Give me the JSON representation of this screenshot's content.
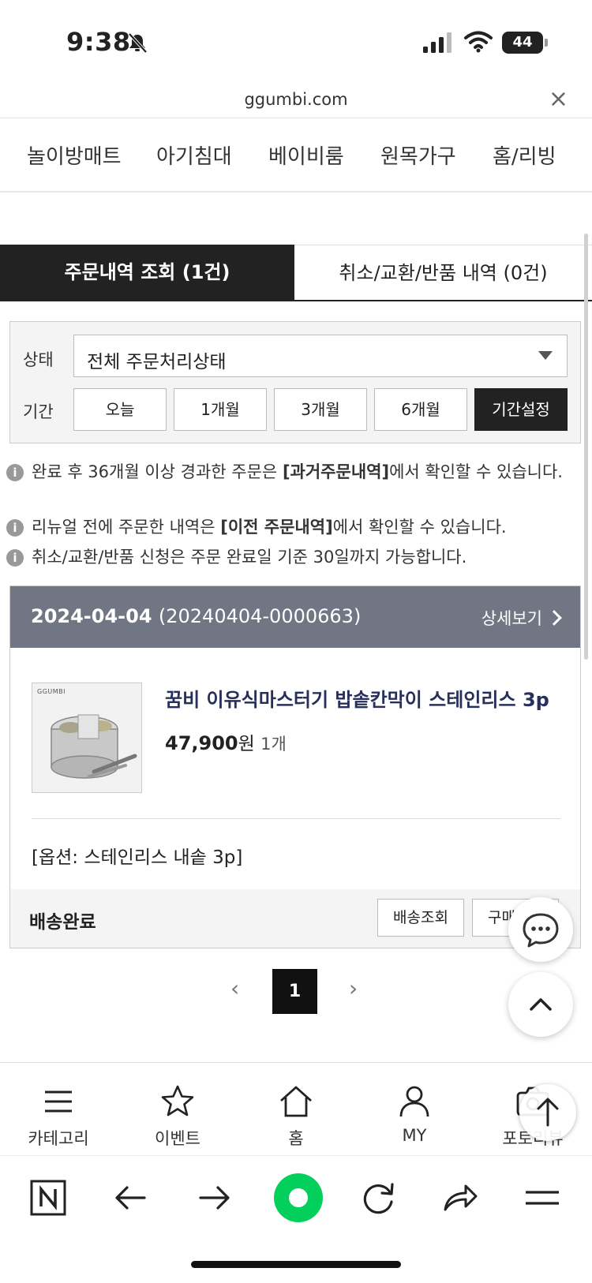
{
  "status_bar": {
    "time": "9:38",
    "battery": "44"
  },
  "browser": {
    "url": "ggumbi.com",
    "close": "×"
  },
  "categories": [
    "놀이방매트",
    "아기침대",
    "베이비룸",
    "원목가구",
    "홈/리빙"
  ],
  "tabs": [
    {
      "label": "주문내역 조회 (1건)",
      "active": true
    },
    {
      "label": "취소/교환/반품 내역 (0건)",
      "active": false
    }
  ],
  "filter": {
    "status_label": "상태",
    "status_value": "전체 주문처리상태",
    "period_label": "기간",
    "periods": [
      "오늘",
      "1개월",
      "3개월",
      "6개월",
      "기간설정"
    ],
    "active_period": "기간설정"
  },
  "notices": [
    {
      "before": "완료 후 36개월 이상 경과한 주문은 ",
      "bold": "[과거주문내역]",
      "after": "에서 확인할 수 있습니다."
    },
    {
      "before": "리뉴얼 전에 주문한 내역은 ",
      "bold": "[이전 주문내역]",
      "after": "에서 확인할 수 있습니다."
    },
    {
      "before": "취소/교환/반품 신청은 주문 완료일 기준 30일까지 가능합니다.",
      "bold": "",
      "after": ""
    }
  ],
  "order": {
    "date": "2024-04-04",
    "number": "(20240404-0000663)",
    "detail_label": "상세보기",
    "product_brand": "GGUMBI",
    "product_name": "꿈비 이유식마스터기 밥솥칸막이 스테인리스 3p",
    "price": "47,900",
    "currency": "원",
    "quantity": "1개",
    "option": "[옵션: 스테인리스 내솥 3p]",
    "status": "배송완료",
    "buttons": [
      "배송조회",
      "구매확정"
    ]
  },
  "pagination": {
    "prev": "‹",
    "current": "1",
    "next": "›"
  },
  "bottom_nav": [
    {
      "label": "카테고리",
      "icon": "menu-icon"
    },
    {
      "label": "이벤트",
      "icon": "star-icon"
    },
    {
      "label": "홈",
      "icon": "home-icon"
    },
    {
      "label": "MY",
      "icon": "user-icon"
    },
    {
      "label": "포토리뷰",
      "icon": "camera-icon"
    }
  ],
  "colors": {
    "dark": "#222222",
    "order_header": "#707684",
    "product_name": "#27305a",
    "naver_green": "#03cf5d"
  }
}
